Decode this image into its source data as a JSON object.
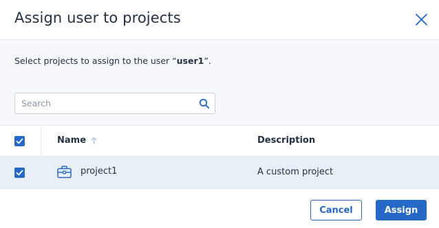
{
  "dialog": {
    "title": "Assign user to projects",
    "intro_prefix": "Select projects to assign to the user “",
    "user": "user1",
    "intro_suffix": "”."
  },
  "search": {
    "placeholder": "Search",
    "value": ""
  },
  "table": {
    "columns": {
      "name": "Name",
      "description": "Description"
    },
    "select_all_checked": true,
    "rows": [
      {
        "checked": true,
        "name": "project1",
        "description": "A custom project",
        "icon": "briefcase-icon"
      }
    ]
  },
  "footer": {
    "cancel_label": "Cancel",
    "assign_label": "Assign"
  },
  "colors": {
    "accent": "#2668c5",
    "row_selected": "#e9eff7",
    "body_bg": "#f6f8fb"
  }
}
